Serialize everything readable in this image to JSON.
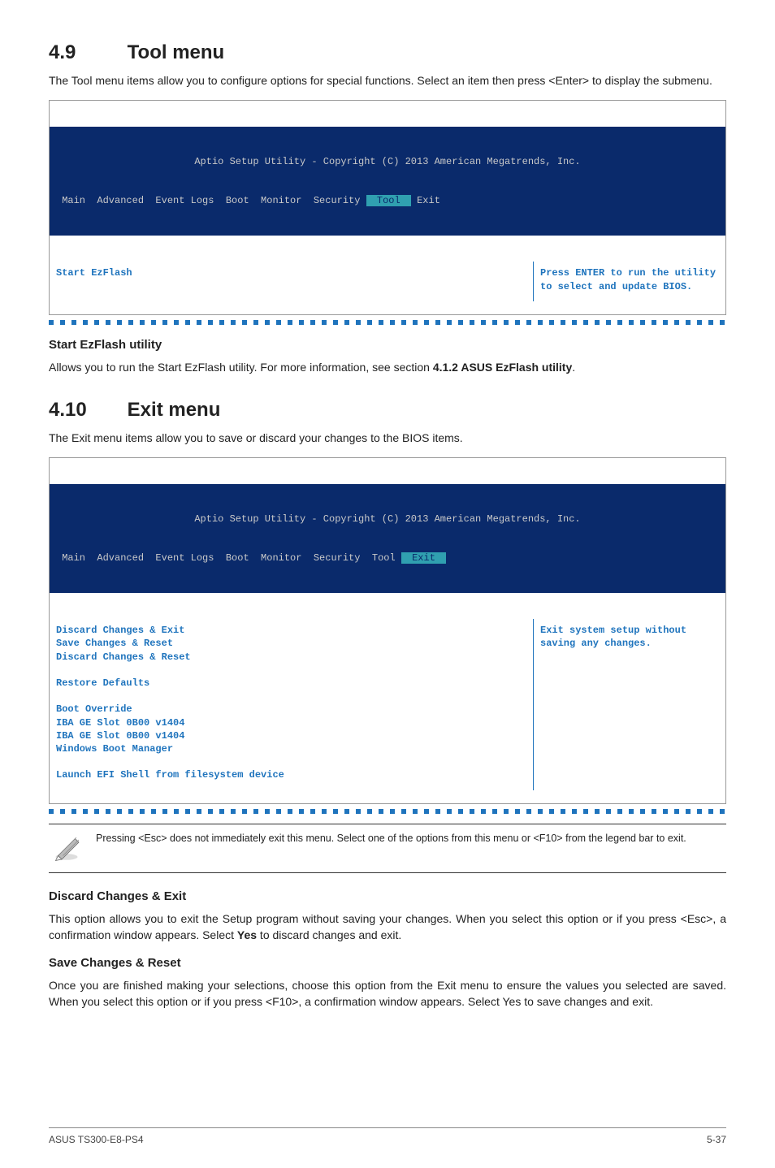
{
  "sections": {
    "tool": {
      "number": "4.9",
      "title": "Tool menu",
      "intro": "The Tool menu items allow you to configure options for special functions. Select an item then press <Enter> to display the submenu."
    },
    "exit": {
      "number": "4.10",
      "title": "Exit menu",
      "intro": "The Exit menu items allow you to save or discard your changes to the BIOS items."
    }
  },
  "bios": {
    "header_line1": "Aptio Setup Utility - Copyright (C) 2013 American Megatrends, Inc.",
    "menubar_prefix": " Main  Advanced  Event Logs  Boot  Monitor  Security ",
    "menubar_tool": " Tool ",
    "menubar_exit": " Exit ",
    "tool_panel": {
      "left": "Start EzFlash",
      "help": "Press ENTER to run the utility to select and update BIOS."
    },
    "exit_panel": {
      "lines": [
        "Discard Changes & Exit",
        "Save Changes & Reset",
        "Discard Changes & Reset",
        "",
        "Restore Defaults",
        "",
        "Boot Override",
        "IBA GE Slot 0B00 v1404",
        "IBA GE Slot 0B00 v1404",
        "Windows Boot Manager",
        "",
        "Launch EFI Shell from filesystem device"
      ],
      "help": "Exit system setup without saving any changes."
    }
  },
  "subsections": {
    "start_ezflash": {
      "title": "Start EzFlash utility",
      "text_a": "Allows you to run the Start EzFlash utility. For more information, see section ",
      "text_b": "4.1.2 ASUS EzFlash utility",
      "text_c": "."
    },
    "note": "Pressing <Esc> does not immediately exit this menu. Select one of the options from this menu or <F10> from the legend bar to exit.",
    "discard": {
      "title": "Discard Changes & Exit",
      "text_a": "This option allows you to exit the Setup program without saving your changes. When you select this option or if you press <Esc>, a confirmation window appears. Select ",
      "text_b": "Yes",
      "text_c": " to discard changes and exit."
    },
    "save": {
      "title": "Save Changes & Reset",
      "text": "Once you are finished making your selections, choose this option from the Exit menu to ensure the values you selected are saved. When you select this option or if you press <F10>, a confirmation window appears. Select Yes to save changes and exit."
    }
  },
  "footer": {
    "left": "ASUS TS300-E8-PS4",
    "right": "5-37"
  }
}
